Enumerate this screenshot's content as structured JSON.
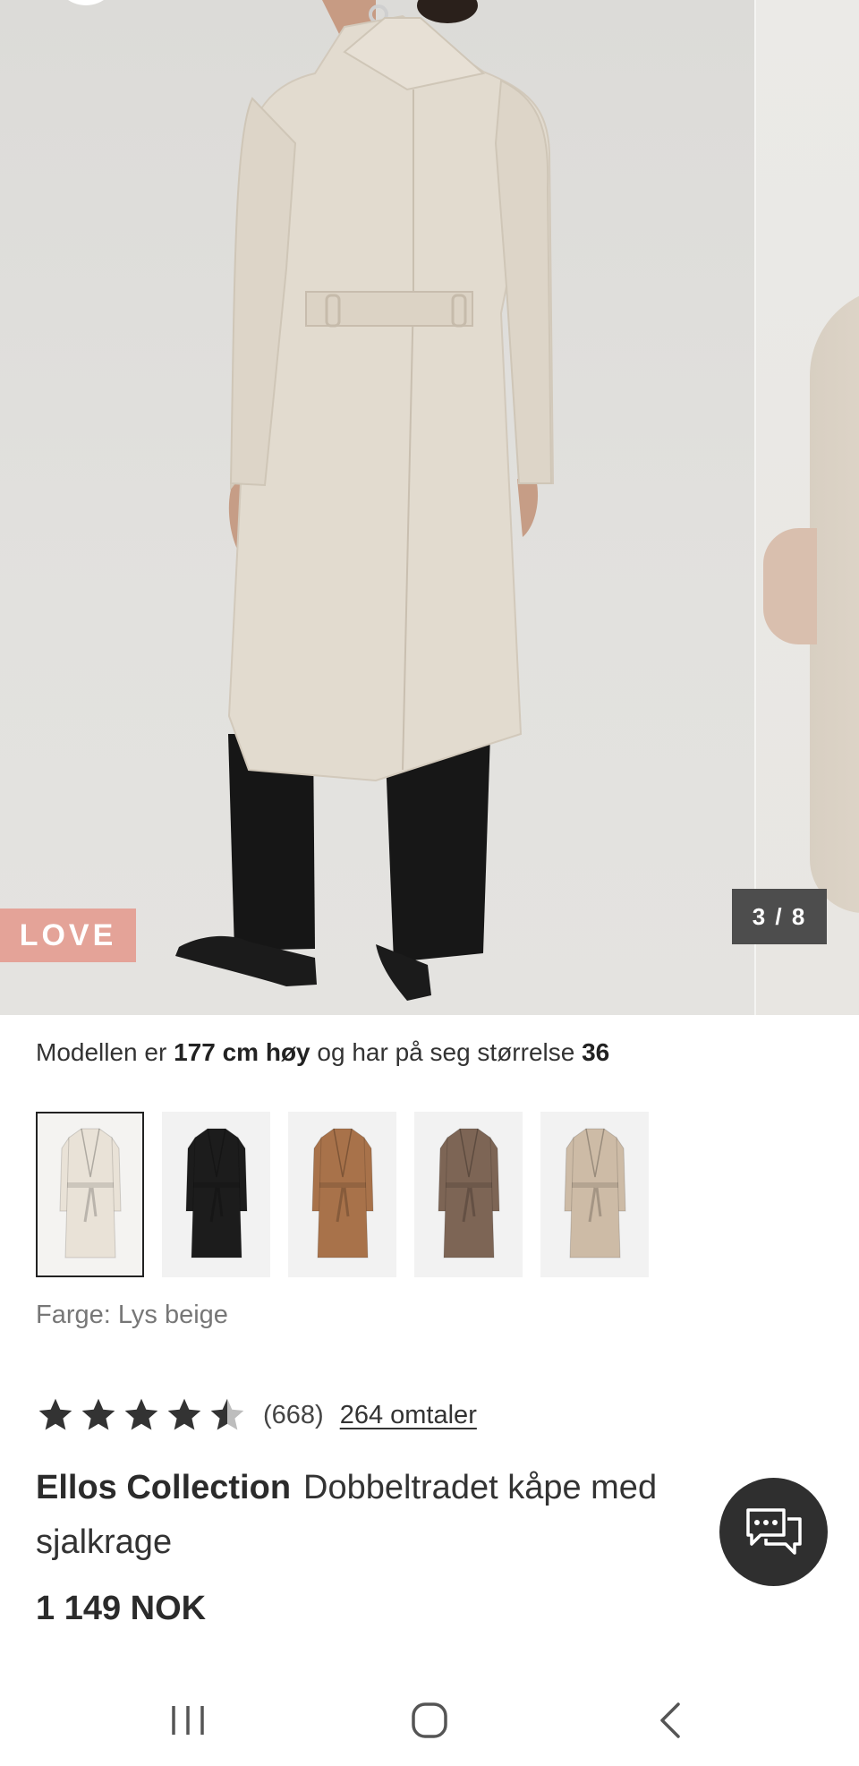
{
  "hero": {
    "badge_label": "LOVE",
    "image_counter": "3 / 8"
  },
  "model_info": {
    "prefix": "Modellen er ",
    "height": "177 cm høy",
    "middle": " og har på seg størrelse ",
    "size": "36"
  },
  "swatches": [
    {
      "name": "Lys beige",
      "coat_color": "#e9e2d7",
      "selected": true
    },
    {
      "name": "Svart",
      "coat_color": "#1c1c1c",
      "selected": false
    },
    {
      "name": "Brun",
      "coat_color": "#a8724a",
      "selected": false
    },
    {
      "name": "Mørk brun",
      "coat_color": "#7d6555",
      "selected": false
    },
    {
      "name": "Beige",
      "coat_color": "#cdbba6",
      "selected": false
    }
  ],
  "color_label": "Farge: Lys beige",
  "rating": {
    "stars": 4.5,
    "count": "(668)",
    "reviews_link": "264 omtaler"
  },
  "product": {
    "brand": "Ellos Collection",
    "name": "Dobbeltradet kåpe med sjalkrage",
    "price": "1 149 NOK"
  },
  "colors": {
    "badge": "#e4a398",
    "counter_bg": "#4d4d4d",
    "chat_bg": "#2f2f2f",
    "star": "#333333"
  },
  "icons": {
    "chat": "chat-bubbles-icon",
    "nav_recent": "recent-apps-icon",
    "nav_home": "home-icon",
    "nav_back": "back-icon"
  }
}
